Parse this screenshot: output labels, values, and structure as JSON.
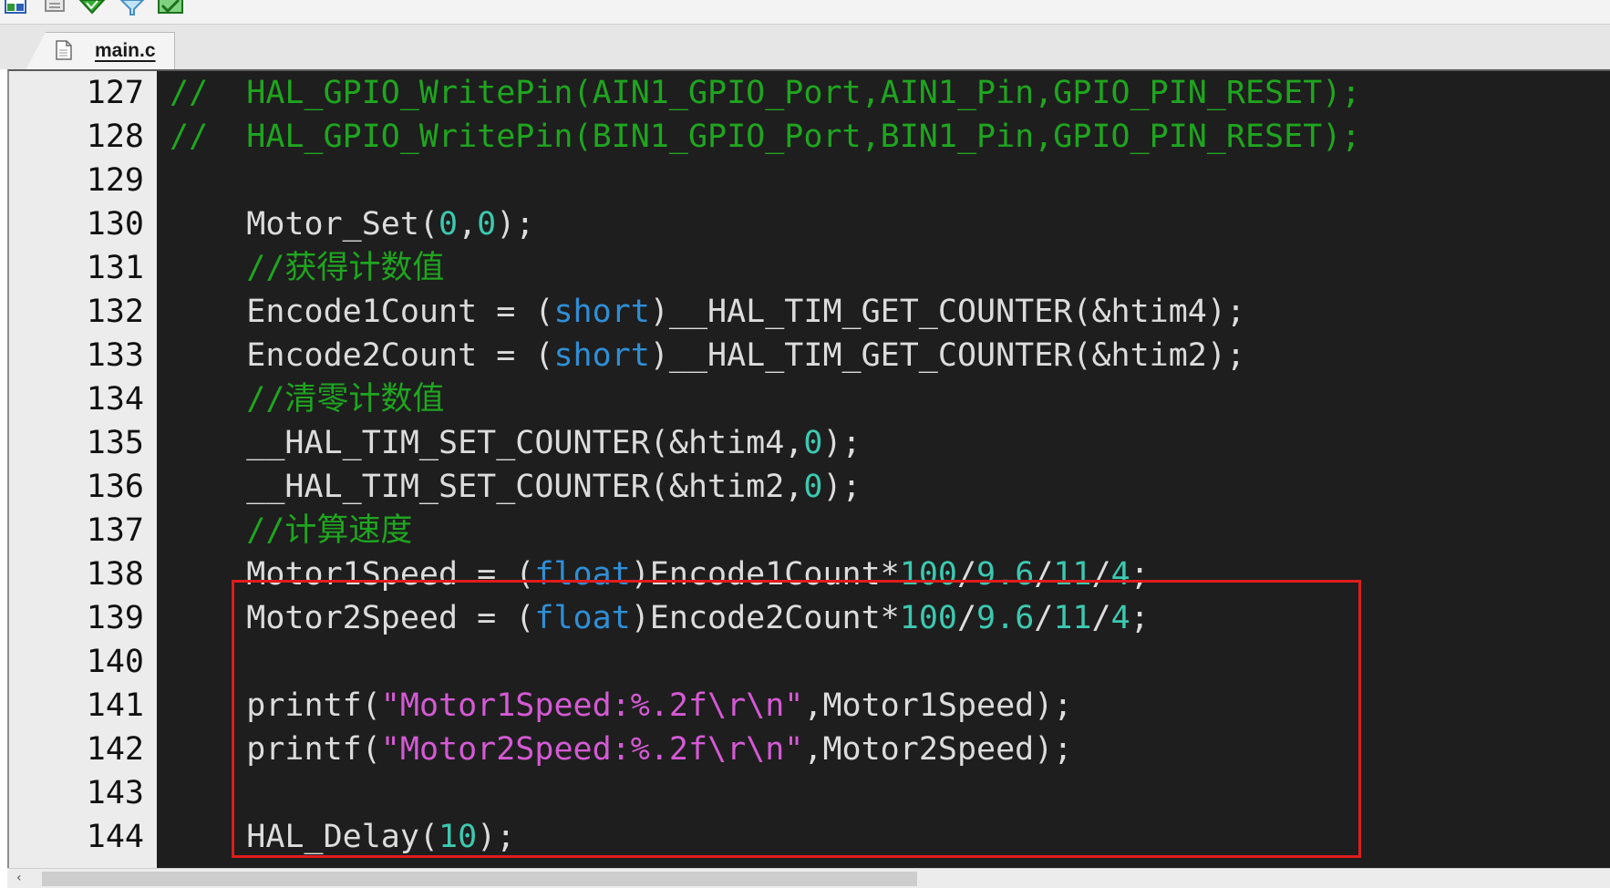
{
  "tab": {
    "label": "main.c",
    "icon": "file-icon"
  },
  "toolbar": {
    "icons": [
      "window-layout-icon",
      "document-icon",
      "green-diamond-icon",
      "funnel-icon",
      "image-check-icon"
    ]
  },
  "colors": {
    "editor_bg": "#1e1e1e",
    "gutter_bg": "#ececec",
    "comment": "#1fa51f",
    "keyword": "#2f8fd6",
    "number": "#3cc9b0",
    "string": "#d45ad4",
    "default_text": "#dcdcdc",
    "highlight_box": "#e01c1c"
  },
  "editor": {
    "lines": [
      {
        "num": "127",
        "kind": "comment",
        "text": "//  HAL_GPIO_WritePin(AIN1_GPIO_Port,AIN1_Pin,GPIO_PIN_RESET);"
      },
      {
        "num": "128",
        "kind": "comment",
        "text": "//  HAL_GPIO_WritePin(BIN1_GPIO_Port,BIN1_Pin,GPIO_PIN_RESET);"
      },
      {
        "num": "129",
        "kind": "code",
        "text": ""
      },
      {
        "num": "130",
        "kind": "code",
        "parts": [
          {
            "t": "    Motor_Set(",
            "c": ""
          },
          {
            "t": "0",
            "c": "num"
          },
          {
            "t": ",",
            "c": ""
          },
          {
            "t": "0",
            "c": "num"
          },
          {
            "t": ");",
            "c": ""
          }
        ]
      },
      {
        "num": "131",
        "kind": "comment",
        "text": "    //获得计数值"
      },
      {
        "num": "132",
        "kind": "code",
        "parts": [
          {
            "t": "    Encode1Count = (",
            "c": ""
          },
          {
            "t": "short",
            "c": "kw"
          },
          {
            "t": ")__HAL_TIM_GET_COUNTER(&htim4);",
            "c": ""
          }
        ]
      },
      {
        "num": "133",
        "kind": "code",
        "parts": [
          {
            "t": "    Encode2Count = (",
            "c": ""
          },
          {
            "t": "short",
            "c": "kw"
          },
          {
            "t": ")__HAL_TIM_GET_COUNTER(&htim2);",
            "c": ""
          }
        ]
      },
      {
        "num": "134",
        "kind": "comment",
        "text": "    //清零计数值"
      },
      {
        "num": "135",
        "kind": "code",
        "parts": [
          {
            "t": "    __HAL_TIM_SET_COUNTER(&htim4,",
            "c": ""
          },
          {
            "t": "0",
            "c": "num"
          },
          {
            "t": ");",
            "c": ""
          }
        ]
      },
      {
        "num": "136",
        "kind": "code",
        "parts": [
          {
            "t": "    __HAL_TIM_SET_COUNTER(&htim2,",
            "c": ""
          },
          {
            "t": "0",
            "c": "num"
          },
          {
            "t": ");",
            "c": ""
          }
        ]
      },
      {
        "num": "137",
        "kind": "comment",
        "text": "    //计算速度"
      },
      {
        "num": "138",
        "kind": "code",
        "parts": [
          {
            "t": "    Motor1Speed = (",
            "c": ""
          },
          {
            "t": "float",
            "c": "kw"
          },
          {
            "t": ")Encode1Count*",
            "c": ""
          },
          {
            "t": "100",
            "c": "num"
          },
          {
            "t": "/",
            "c": ""
          },
          {
            "t": "9.6",
            "c": "num"
          },
          {
            "t": "/",
            "c": ""
          },
          {
            "t": "11",
            "c": "num"
          },
          {
            "t": "/",
            "c": ""
          },
          {
            "t": "4",
            "c": "num"
          },
          {
            "t": ";",
            "c": ""
          }
        ]
      },
      {
        "num": "139",
        "kind": "code",
        "parts": [
          {
            "t": "    Motor2Speed = (",
            "c": ""
          },
          {
            "t": "float",
            "c": "kw"
          },
          {
            "t": ")Encode2Count*",
            "c": ""
          },
          {
            "t": "100",
            "c": "num"
          },
          {
            "t": "/",
            "c": ""
          },
          {
            "t": "9.6",
            "c": "num"
          },
          {
            "t": "/",
            "c": ""
          },
          {
            "t": "11",
            "c": "num"
          },
          {
            "t": "/",
            "c": ""
          },
          {
            "t": "4",
            "c": "num"
          },
          {
            "t": ";",
            "c": ""
          }
        ]
      },
      {
        "num": "140",
        "kind": "code",
        "text": ""
      },
      {
        "num": "141",
        "kind": "code",
        "parts": [
          {
            "t": "    printf(",
            "c": ""
          },
          {
            "t": "\"Motor1Speed:%.2f\\r\\n\"",
            "c": "str"
          },
          {
            "t": ",Motor1Speed);",
            "c": ""
          }
        ]
      },
      {
        "num": "142",
        "kind": "code",
        "parts": [
          {
            "t": "    printf(",
            "c": ""
          },
          {
            "t": "\"Motor2Speed:%.2f\\r\\n\"",
            "c": "str"
          },
          {
            "t": ",Motor2Speed);",
            "c": ""
          }
        ]
      },
      {
        "num": "143",
        "kind": "code",
        "text": ""
      },
      {
        "num": "144",
        "kind": "code",
        "parts": [
          {
            "t": "    HAL_Delay(",
            "c": ""
          },
          {
            "t": "10",
            "c": "num"
          },
          {
            "t": ");",
            "c": ""
          }
        ]
      }
    ]
  },
  "scrollbar": {
    "left_arrow": "‹"
  }
}
